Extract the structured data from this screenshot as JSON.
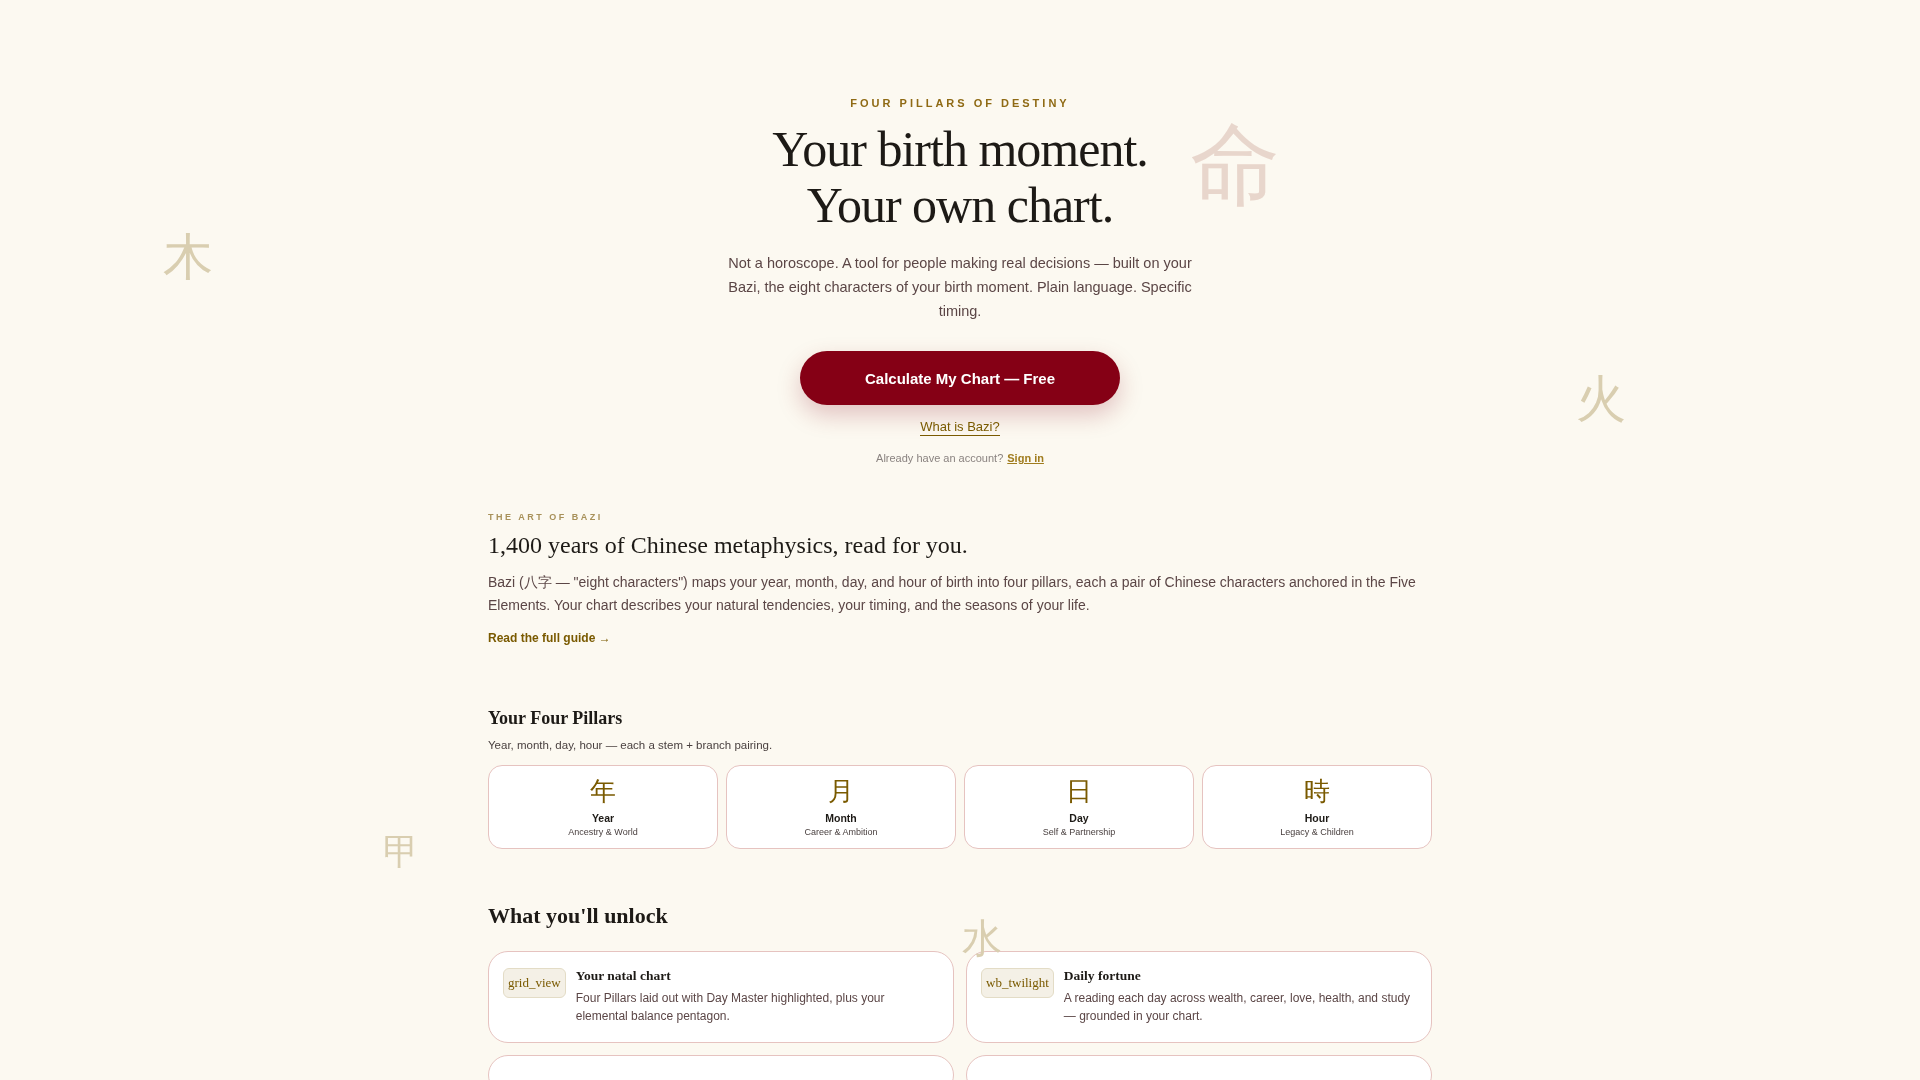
{
  "background_glyphs": [
    {
      "char": "命"
    },
    {
      "char": "木"
    },
    {
      "char": "火"
    },
    {
      "char": "甲"
    },
    {
      "char": "水"
    }
  ],
  "hero": {
    "eyebrow": "FOUR PILLARS OF DESTINY",
    "title_lines": [
      "Your birth moment.",
      "Your own chart."
    ],
    "intro": "Not a horoscope. A tool for people making real decisions — built on your Bazi, the eight characters of your birth moment. Plain language. Specific timing.",
    "cta": "Calculate My Chart — Free",
    "secondary_link": "What is Bazi?",
    "signin_prompt": "Already have an account?",
    "signin_link": "Sign in"
  },
  "art": {
    "eyebrow": "THE ART OF BAZI",
    "heading": "1,400 years of Chinese metaphysics, read for you.",
    "body": "Bazi (八字 — \"eight characters\") maps your year, month, day, and hour of birth into four pillars, each a pair of Chinese characters anchored in the Five Elements. Your chart describes your natural tendencies, your timing, and the seasons of your life.",
    "link": "Read the full guide →"
  },
  "pillars": {
    "heading": "Your Four Pillars",
    "subheading": "Year, month, day, hour — each a stem + branch pairing.",
    "items": [
      {
        "glyph": "年",
        "label": "Year",
        "meaning": "Ancestry & World"
      },
      {
        "glyph": "月",
        "label": "Month",
        "meaning": "Career & Ambition"
      },
      {
        "glyph": "日",
        "label": "Day",
        "meaning": "Self & Partnership"
      },
      {
        "glyph": "時",
        "label": "Hour",
        "meaning": "Legacy & Children"
      }
    ]
  },
  "unlock": {
    "heading": "What you'll unlock",
    "cards": [
      {
        "icon": "grid_view",
        "title": "Your natal chart",
        "body": "Four Pillars laid out with Day Master highlighted, plus your elemental balance pentagon."
      },
      {
        "icon": "wb_twilight",
        "title": "Daily fortune",
        "body": "A reading each day across wealth, career, love, health, and study — grounded in your chart."
      }
    ]
  }
}
